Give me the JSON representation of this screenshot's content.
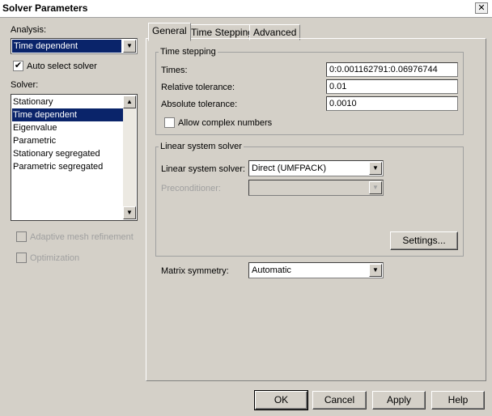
{
  "window": {
    "title": "Solver Parameters",
    "close_glyph": "✕"
  },
  "left": {
    "analysis_label": "Analysis:",
    "analysis_value": "Time dependent",
    "auto_select_label": "Auto select solver",
    "solver_label": "Solver:",
    "solvers": [
      "Stationary",
      "Time dependent",
      "Eigenvalue",
      "Parametric",
      "Stationary segregated",
      "Parametric segregated"
    ],
    "selected_solver": "Time dependent",
    "adaptive_label": "Adaptive mesh refinement",
    "optimization_label": "Optimization"
  },
  "tabs": [
    {
      "label": "General",
      "active": true
    },
    {
      "label": "Time Stepping",
      "active": false
    },
    {
      "label": "Advanced",
      "active": false
    }
  ],
  "time_stepping": {
    "title": "Time stepping",
    "times_label": "Times:",
    "times_value": "0:0.001162791:0.06976744",
    "rel_tol_label": "Relative tolerance:",
    "rel_tol_value": "0.01",
    "abs_tol_label": "Absolute tolerance:",
    "abs_tol_value": "0.0010",
    "complex_label": "Allow complex numbers"
  },
  "linear_solver": {
    "title": "Linear system solver",
    "solver_label": "Linear system solver:",
    "solver_value": "Direct (UMFPACK)",
    "preconditioner_label": "Preconditioner:",
    "preconditioner_value": "",
    "settings_label": "Settings..."
  },
  "matrix": {
    "label": "Matrix symmetry:",
    "value": "Automatic"
  },
  "buttons": {
    "ok": "OK",
    "cancel": "Cancel",
    "apply": "Apply",
    "help": "Help"
  },
  "icons": {
    "dropdown_arrow": "▼",
    "scroll_up": "▲",
    "scroll_down": "▼",
    "check": "✔"
  }
}
